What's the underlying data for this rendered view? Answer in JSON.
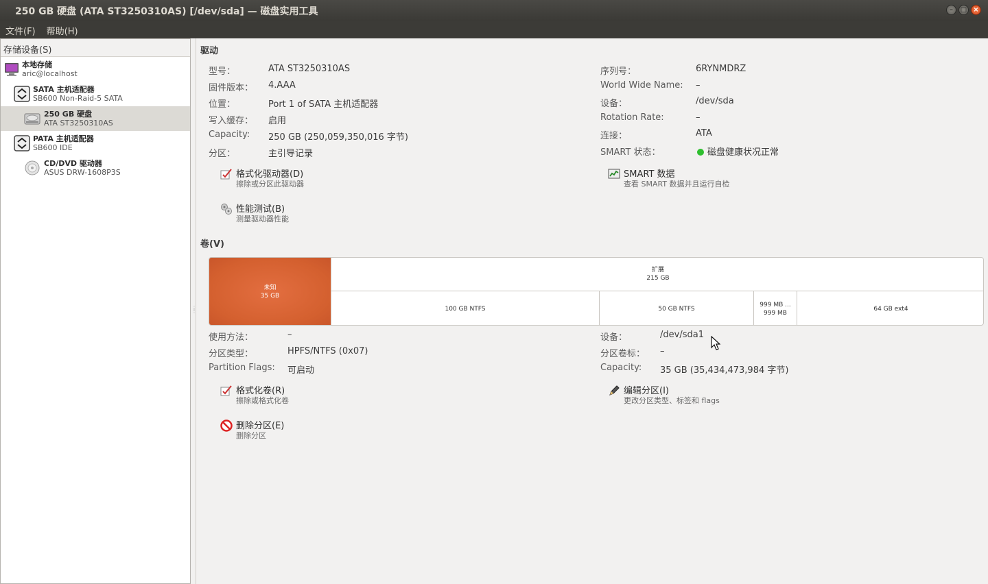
{
  "window": {
    "title": "250 GB 硬盘 (ATA ST3250310AS) [/dev/sda] — 磁盘实用工具"
  },
  "menu": [
    "文件(F)",
    "帮助(H)"
  ],
  "sidebar": {
    "header": "存储设备(S)",
    "devices": [
      {
        "name": "本地存储",
        "sub": "aric@localhost",
        "icon": "computer-icon",
        "level": 0
      },
      {
        "name": "SATA 主机适配器",
        "sub": "SB600 Non-Raid-5 SATA",
        "icon": "host-adapter-icon",
        "level": 1
      },
      {
        "name": "250 GB 硬盘",
        "sub": "ATA ST3250310AS",
        "icon": "hard-disk-icon",
        "level": 2,
        "selected": true
      },
      {
        "name": "PATA 主机适配器",
        "sub": "SB600 IDE",
        "icon": "host-adapter-icon",
        "level": 1
      },
      {
        "name": "CD/DVD 驱动器",
        "sub": "ASUS DRW-1608P3S",
        "icon": "optical-drive-icon",
        "level": 2
      }
    ]
  },
  "drive": {
    "section_title": "驱动",
    "left": [
      {
        "k": "型号：",
        "v": "ATA ST3250310AS"
      },
      {
        "k": "固件版本：",
        "v": "4.AAA"
      },
      {
        "k": "位置：",
        "v": "Port 1 of SATA 主机适配器"
      },
      {
        "k": "写入缓存：",
        "v": "启用"
      },
      {
        "k": "Capacity:",
        "v": "250 GB (250,059,350,016 字节)"
      },
      {
        "k": "分区：",
        "v": "主引导记录"
      }
    ],
    "right": [
      {
        "k": "序列号：",
        "v": "6RYNMDRZ"
      },
      {
        "k": "World Wide Name:",
        "v": "–"
      },
      {
        "k": "设备：",
        "v": "/dev/sda"
      },
      {
        "k": "Rotation Rate:",
        "v": "–"
      },
      {
        "k": "连接：",
        "v": "ATA"
      },
      {
        "k": "SMART 状态：",
        "v": "磁盘健康状况正常"
      }
    ],
    "actions": [
      {
        "label": "格式化驱动器(D)",
        "desc": "擦除或分区此驱动器",
        "icon": "format-drive-icon"
      },
      {
        "label": "性能测试(B)",
        "desc": "测量驱动器性能",
        "icon": "benchmark-icon"
      },
      {
        "label": "SMART 数据",
        "desc": "查看 SMART 数据并且运行自检",
        "icon": "smart-data-icon"
      }
    ]
  },
  "volumes": {
    "section_title": "卷(V)",
    "graph": {
      "unknown": {
        "name": "未知",
        "size": "35 GB"
      },
      "extended": {
        "name": "扩展",
        "size": "215 GB"
      },
      "partitions": [
        "100 GB NTFS",
        "50 GB NTFS",
        "999 MB ...",
        "999 MB",
        "64 GB ext4"
      ]
    },
    "left": [
      {
        "k": "使用方法：",
        "v": "–"
      },
      {
        "k": "分区类型：",
        "v": "HPFS/NTFS (0x07)"
      },
      {
        "k": "Partition Flags:",
        "v": "可启动"
      }
    ],
    "right": [
      {
        "k": "设备：",
        "v": "/dev/sda1"
      },
      {
        "k": "分区卷标：",
        "v": "–"
      },
      {
        "k": "Capacity:",
        "v": "35 GB (35,434,473,984 字节)"
      }
    ],
    "actions": [
      {
        "label": "格式化卷(R)",
        "desc": "擦除或格式化卷",
        "icon": "format-volume-icon"
      },
      {
        "label": "删除分区(E)",
        "desc": "删除分区",
        "icon": "delete-partition-icon"
      },
      {
        "label": "编辑分区(I)",
        "desc": "更改分区类型、标签和 flags",
        "icon": "edit-partition-icon"
      }
    ]
  },
  "colors": {
    "unknown_partition": "#d4602f",
    "smart_ok": "#2fbf2f",
    "titlebar": "#3c3b37"
  }
}
